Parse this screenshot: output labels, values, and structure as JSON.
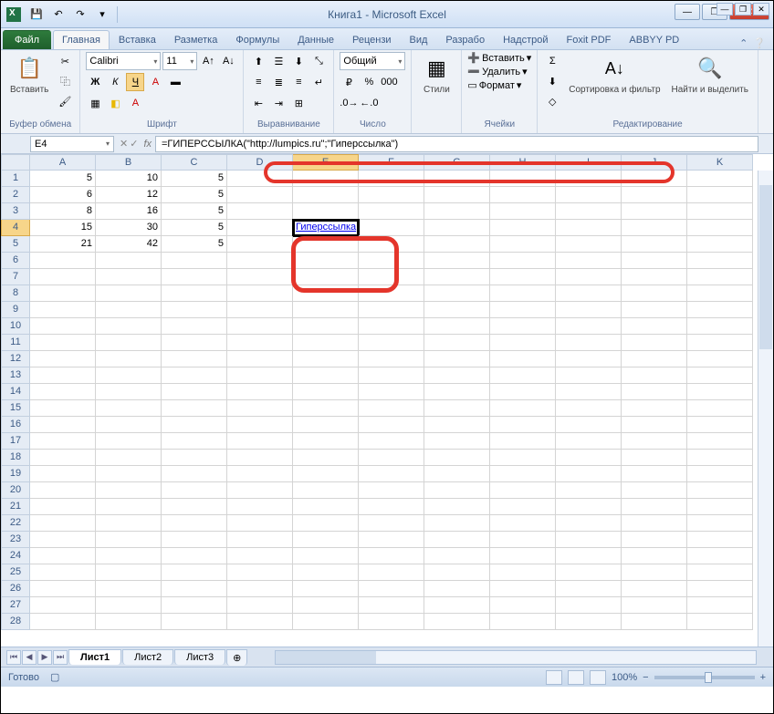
{
  "title": "Книга1 - Microsoft Excel",
  "tabs": {
    "file": "Файл",
    "home": "Главная",
    "insert": "Вставка",
    "layout": "Разметка",
    "formulas": "Формулы",
    "data": "Данные",
    "review": "Рецензи",
    "view": "Вид",
    "dev": "Разрабо",
    "addins": "Надстрой",
    "foxit": "Foxit PDF",
    "abbyy": "ABBYY PD"
  },
  "ribbon": {
    "clipboard": {
      "paste": "Вставить",
      "label": "Буфер обмена"
    },
    "font": {
      "name": "Calibri",
      "size": "11",
      "label": "Шрифт",
      "bold": "Ж",
      "italic": "К",
      "underline": "Ч"
    },
    "align": {
      "label": "Выравнивание"
    },
    "number": {
      "format": "Общий",
      "label": "Число"
    },
    "styles": {
      "btn": "Стили"
    },
    "cells": {
      "insert": "Вставить",
      "delete": "Удалить",
      "format": "Формат",
      "label": "Ячейки"
    },
    "editing": {
      "sort": "Сортировка и фильтр",
      "find": "Найти и выделить",
      "label": "Редактирование"
    }
  },
  "namebox": "E4",
  "formula": "=ГИПЕРССЫЛКА(\"http://lumpics.ru\";\"Гиперссылка\")",
  "columns": [
    "A",
    "B",
    "C",
    "D",
    "E",
    "F",
    "G",
    "H",
    "I",
    "J",
    "K"
  ],
  "rows": [
    "1",
    "2",
    "3",
    "4",
    "5",
    "6",
    "7",
    "8",
    "9",
    "10",
    "11",
    "12",
    "13",
    "14",
    "15",
    "16",
    "17",
    "18",
    "19",
    "20",
    "21",
    "22",
    "23",
    "24",
    "25",
    "26",
    "27",
    "28"
  ],
  "chart_data": {
    "type": "table",
    "columns": [
      "A",
      "B",
      "C"
    ],
    "values": [
      [
        5,
        10,
        5
      ],
      [
        6,
        12,
        5
      ],
      [
        8,
        16,
        5
      ],
      [
        15,
        30,
        5
      ],
      [
        21,
        42,
        5
      ]
    ]
  },
  "hyperlink_cell": "Гиперссылка",
  "sheets": {
    "s1": "Лист1",
    "s2": "Лист2",
    "s3": "Лист3"
  },
  "status": {
    "ready": "Готово",
    "zoom": "100%"
  }
}
